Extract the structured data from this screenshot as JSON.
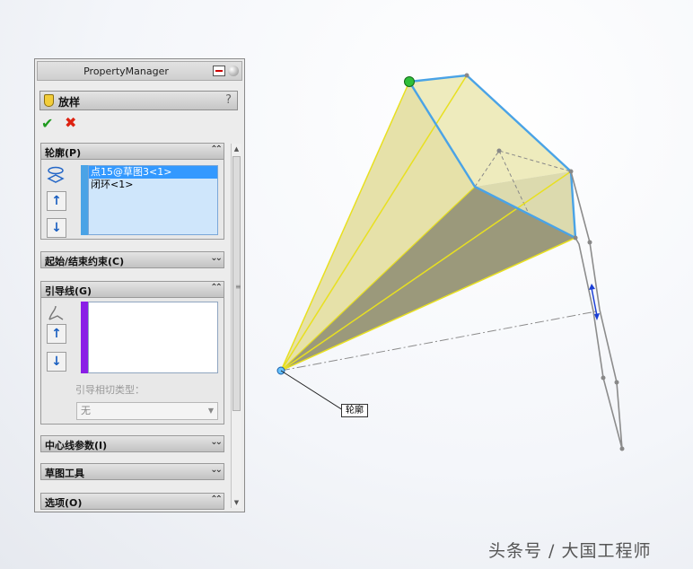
{
  "panel": {
    "title": "PropertyManager",
    "feature_title": "放样",
    "help": "?",
    "ok_glyph": "✔",
    "cancel_glyph": "✖"
  },
  "sections": {
    "profiles": {
      "label": "轮廓(P)",
      "chevron": "⌃⌃",
      "items": [
        "点15@草图3<1>",
        "闭环<1>"
      ]
    },
    "start_end": {
      "label": "起始/结束约束(C)",
      "chevron": "⌄⌄"
    },
    "guides": {
      "label": "引导线(G)",
      "chevron": "⌃⌃",
      "tangency_label": "引导相切类型：",
      "tangency_value": "无"
    },
    "centerline": {
      "label": "中心线参数(I)",
      "chevron": "⌄⌄"
    },
    "sketch_tools": {
      "label": "草图工具",
      "chevron": "⌄⌄"
    },
    "options": {
      "label": "选项(O)",
      "chevron": "⌃⌃"
    }
  },
  "viewport": {
    "callout": "轮廓",
    "colors": {
      "edge_blue": "#4aa3e6",
      "face_yellow": "#e6e6a8",
      "guide_gray": "#8c8c8c"
    }
  },
  "watermark": "头条号 / 大国工程师"
}
